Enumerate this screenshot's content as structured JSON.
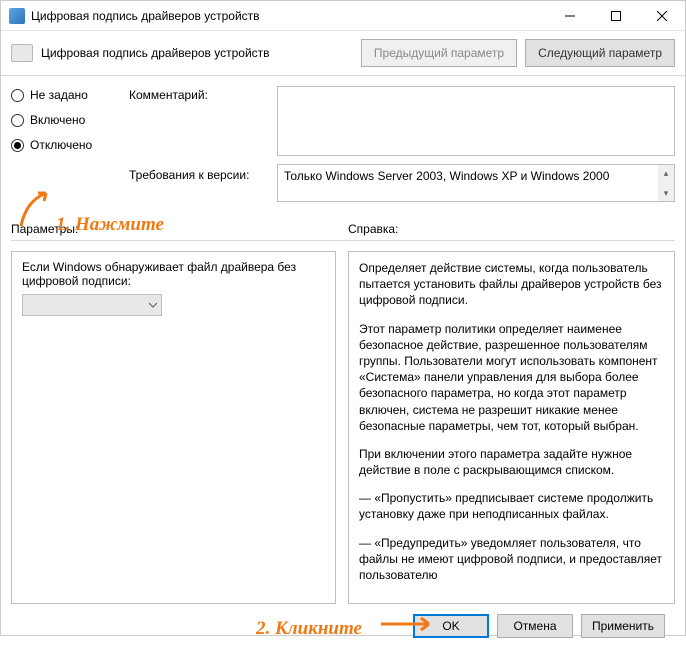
{
  "window": {
    "title": "Цифровая подпись драйверов устройств"
  },
  "header": {
    "title": "Цифровая подпись драйверов устройств",
    "prev": "Предыдущий параметр",
    "next": "Следующий параметр"
  },
  "radios": {
    "not_configured": "Не задано",
    "enabled": "Включено",
    "disabled": "Отключено",
    "selected": "disabled"
  },
  "labels": {
    "comment": "Комментарий:",
    "requirements": "Требования к версии:",
    "parameters": "Параметры:",
    "help": "Справка:"
  },
  "comment_value": "",
  "requirements_value": "Только Windows Server 2003, Windows XP и Windows 2000",
  "parameters_text": "Если Windows обнаруживает файл драйвера без цифровой подписи:",
  "dropdown_value": "",
  "help_paragraphs": [
    "Определяет действие системы, когда пользователь пытается установить файлы драйверов устройств без цифровой подписи.",
    "Этот параметр политики определяет наименее безопасное действие, разрешенное пользователям группы. Пользователи могут использовать компонент «Система» панели управления для выбора более безопасного параметра, но когда этот параметр включен, система не разрешит никакие менее безопасные параметры, чем тот, который выбран.",
    "При включении этого параметра задайте нужное действие в поле с раскрывающимся списком.",
    "— «Пропустить» предписывает системе продолжить установку даже при неподписанных файлах.",
    "— «Предупредить» уведомляет пользователя, что файлы не имеют цифровой подписи, и предоставляет пользователю"
  ],
  "footer": {
    "ok": "OK",
    "cancel": "Отмена",
    "apply": "Применить"
  },
  "annotations": {
    "step1": "1. Нажмите",
    "step2": "2. Кликните"
  }
}
